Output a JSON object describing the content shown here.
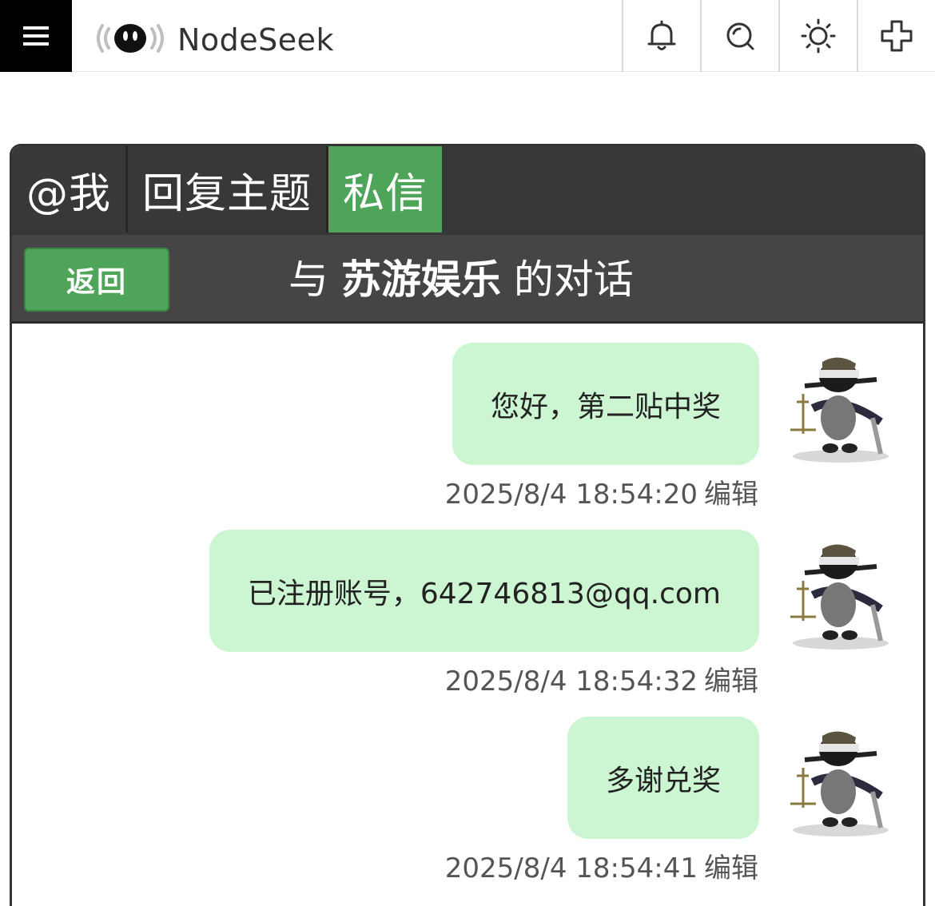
{
  "header": {
    "brand": "NodeSeek",
    "menu_icon": "hamburger-icon",
    "actions": [
      {
        "name": "notifications",
        "icon": "bell-icon"
      },
      {
        "name": "search",
        "icon": "search-icon"
      },
      {
        "name": "theme",
        "icon": "sun-icon"
      },
      {
        "name": "new-post",
        "icon": "plus-icon"
      }
    ]
  },
  "tabs": [
    {
      "label": "@我",
      "active": false
    },
    {
      "label": "回复主题",
      "active": false
    },
    {
      "label": "私信",
      "active": true
    }
  ],
  "conversation": {
    "back_label": "返回",
    "title_prefix": "与",
    "partner": "苏游娱乐",
    "title_suffix": "的对话"
  },
  "messages": [
    {
      "text": "您好，第二贴中奖",
      "time": "2025/8/4 18:54:20",
      "edit": "编辑"
    },
    {
      "text": "已注册账号，642746813@qq.com",
      "time": "2025/8/4 18:54:32",
      "edit": "编辑"
    },
    {
      "text": "多谢兑奖",
      "time": "2025/8/4 18:54:41",
      "edit": "编辑"
    }
  ],
  "colors": {
    "accent": "#4ea459",
    "bubble": "#ccf5d2",
    "tabbar": "#383838",
    "header_bar": "#454545"
  }
}
